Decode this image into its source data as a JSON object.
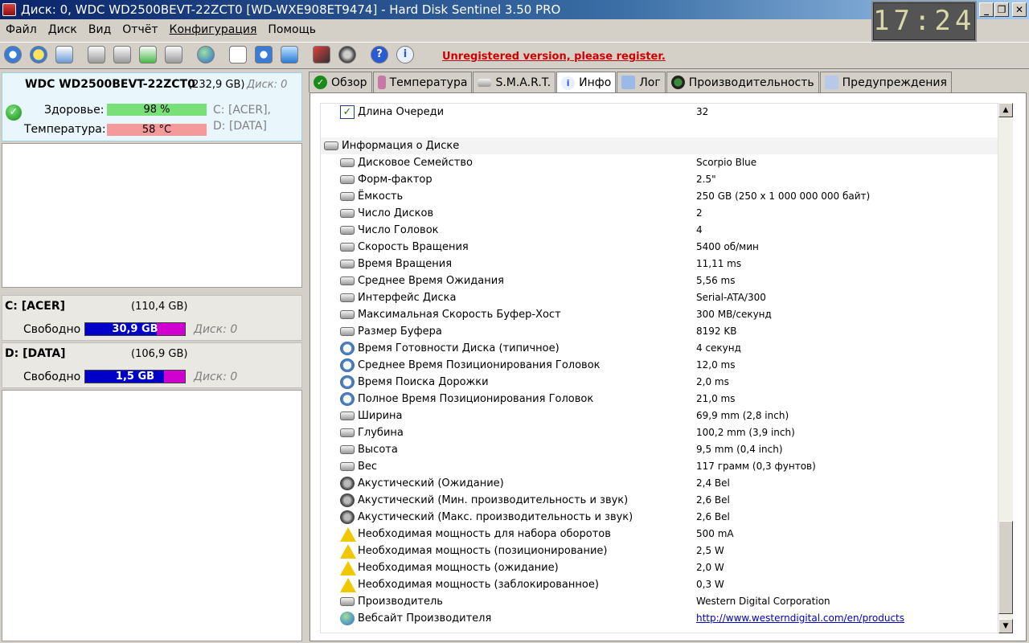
{
  "window": {
    "title": "Диск: 0, WDC WD2500BEVT-22ZCT0 [WD-WXE908ET9474]  -  Hard Disk Sentinel 3.50 PRO",
    "clock": "17:24"
  },
  "menu": [
    "Файл",
    "Диск",
    "Вид",
    "Отчёт",
    "Конфигурация",
    "Помощь"
  ],
  "toolbar": {
    "buttons": [
      "refresh-icon",
      "alert-icon",
      "disk-info-icon",
      "disk-test-icon",
      "disk-scan-icon",
      "disk-ok-icon",
      "disk-tools-icon",
      "globe-icon",
      "report-icon",
      "sync-icon",
      "network-icon",
      "chart-icon",
      "sound-icon",
      "help-icon",
      "info-icon"
    ],
    "unregistered": "Unregistered version, please register."
  },
  "disk": {
    "name": "WDC WD2500BEVT-22ZCT0",
    "size": "(232,9 GB)",
    "number": "Диск: 0",
    "health_label": "Здоровье:",
    "health_value": "98 %",
    "temp_label": "Температура:",
    "temp_value": "58 °C",
    "partitions_line1": "C: [ACER],",
    "partitions_line2": "D: [DATA]",
    "colors": {
      "health_bar": "#79e079",
      "temp_bar": "#f59a9a"
    }
  },
  "partitions": [
    {
      "name": "C: [ACER]",
      "size": "(110,4 GB)",
      "free_label": "Свободно",
      "free": "30,9 GB",
      "free_fraction": 0.28,
      "disk": "Диск: 0"
    },
    {
      "name": "D: [DATA]",
      "size": "(106,9 GB)",
      "free_label": "Свободно",
      "free": "1,5 GB",
      "free_fraction": 0.014,
      "disk": "Диск: 0"
    }
  ],
  "tabs": [
    {
      "label": "Обзор",
      "icon": "check-icon"
    },
    {
      "label": "Температура",
      "icon": "thermometer-icon"
    },
    {
      "label": "S.M.A.R.T.",
      "icon": "disk-icon"
    },
    {
      "label": "Инфо",
      "icon": "info-icon",
      "active": true
    },
    {
      "label": "Лог",
      "icon": "log-icon"
    },
    {
      "label": "Производительность",
      "icon": "gauge-icon"
    },
    {
      "label": "Предупреждения",
      "icon": "warning-doc-icon"
    }
  ],
  "info_rows": [
    {
      "icon": "check",
      "label": "Длина Очереди",
      "value": "32"
    },
    {
      "icon": "none",
      "label": "",
      "value": ""
    },
    {
      "icon": "disk",
      "label": "Информация о Диске",
      "value": "",
      "section": true
    },
    {
      "icon": "disk",
      "label": "Дисковое Семейство",
      "value": "Scorpio Blue"
    },
    {
      "icon": "disk",
      "label": "Форм-фактор",
      "value": "2.5\""
    },
    {
      "icon": "disk",
      "label": "Ёмкость",
      "value": "250 GB (250 x 1 000 000 000 байт)"
    },
    {
      "icon": "disk",
      "label": "Число Дисков",
      "value": "2"
    },
    {
      "icon": "disk",
      "label": "Число Головок",
      "value": "4"
    },
    {
      "icon": "disk",
      "label": "Скорость Вращения",
      "value": "5400 об/мин"
    },
    {
      "icon": "disk",
      "label": "Время Вращения",
      "value": "11,11 ms"
    },
    {
      "icon": "disk",
      "label": "Среднее Время Ожидания",
      "value": "5,56 ms"
    },
    {
      "icon": "disk",
      "label": "Интерфейс Диска",
      "value": "Serial-ATA/300"
    },
    {
      "icon": "disk",
      "label": "Максимальная Скорость Буфер-Хост",
      "value": "300 MB/секунд"
    },
    {
      "icon": "disk",
      "label": "Размер Буфера",
      "value": "8192 KB"
    },
    {
      "icon": "clock",
      "label": "Время Готовности Диска (типичное)",
      "value": "4 секунд"
    },
    {
      "icon": "clock",
      "label": "Среднее Время Позиционирования Головок",
      "value": "12,0 ms"
    },
    {
      "icon": "clock",
      "label": "Время Поиска Дорожки",
      "value": "2,0 ms"
    },
    {
      "icon": "clock",
      "label": "Полное Время Позиционирования Головок",
      "value": "21,0 ms"
    },
    {
      "icon": "disk",
      "label": "Ширина",
      "value": "69,9 mm (2,8 inch)"
    },
    {
      "icon": "disk",
      "label": "Глубина",
      "value": "100,2 mm (3,9 inch)"
    },
    {
      "icon": "disk",
      "label": "Высота",
      "value": "9,5 mm (0,4 inch)"
    },
    {
      "icon": "disk",
      "label": "Вес",
      "value": "117 грамм (0,3 фунтов)"
    },
    {
      "icon": "sound",
      "label": "Акустический (Ожидание)",
      "value": "2,4 Bel"
    },
    {
      "icon": "sound",
      "label": "Акустический (Мин. производительность и звук)",
      "value": "2,6 Bel"
    },
    {
      "icon": "sound",
      "label": "Акустический (Макс. производительность и звук)",
      "value": "2,6 Bel"
    },
    {
      "icon": "warn",
      "label": "Необходимая мощность для набора оборотов",
      "value": "500 mA"
    },
    {
      "icon": "warn",
      "label": "Необходимая мощность (позиционирование)",
      "value": "2,5 W"
    },
    {
      "icon": "warn",
      "label": "Необходимая мощность (ожидание)",
      "value": "2,0 W"
    },
    {
      "icon": "warn",
      "label": "Необходимая мощность (заблокированное)",
      "value": "0,3 W"
    },
    {
      "icon": "disk",
      "label": "Производитель",
      "value": "Western Digital Corporation"
    },
    {
      "icon": "globe",
      "label": "Вебсайт Производителя",
      "value": "http://www.westerndigital.com/en/products",
      "link": true
    }
  ]
}
